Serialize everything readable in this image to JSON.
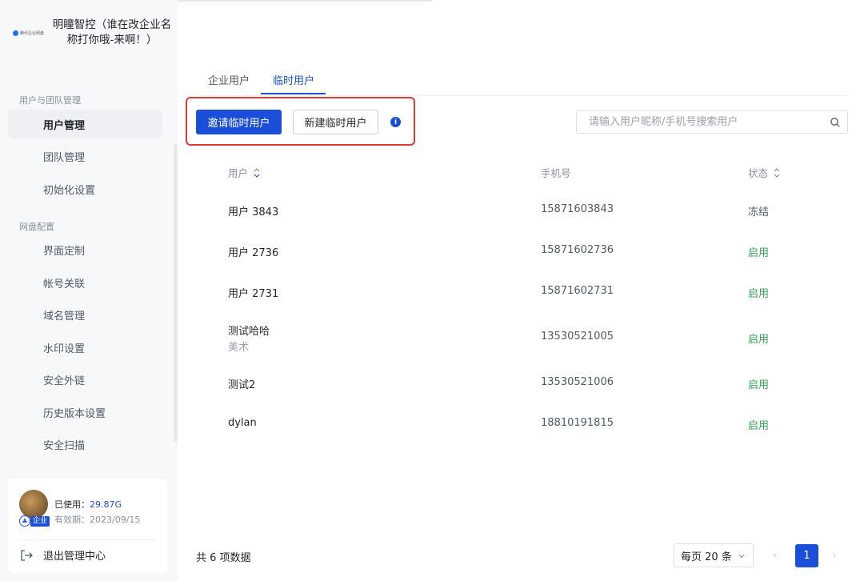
{
  "brand": {
    "name": "明瞳智控（谁在改企业名称打你哦-来啊！）",
    "logo_text": "腾讯企业网盘",
    "accent_color": "#1b4fd8"
  },
  "sidebar": {
    "sections": [
      {
        "label": "用户与团队管理"
      },
      {
        "label": "网盘配置"
      }
    ],
    "items": [
      {
        "label": "用户管理",
        "active": true
      },
      {
        "label": "团队管理"
      },
      {
        "label": "初始化设置"
      },
      {
        "label": "界面定制"
      },
      {
        "label": "帐号关联"
      },
      {
        "label": "域名管理"
      },
      {
        "label": "水印设置"
      },
      {
        "label": "安全外链"
      },
      {
        "label": "历史版本设置"
      },
      {
        "label": "安全扫描"
      }
    ],
    "account": {
      "used_label": "已使用：",
      "used_value": "29.87G",
      "expiry_label": "有效期：",
      "expiry_value": "2023/09/15",
      "badge": "企业"
    },
    "logout_label": "退出管理中心"
  },
  "tabs": [
    {
      "label": "企业用户",
      "active": false
    },
    {
      "label": "临时用户",
      "active": true
    }
  ],
  "toolbar": {
    "invite_label": "邀请临时用户",
    "create_label": "新建临时用户",
    "info_glyph": "i",
    "search_placeholder": "请输入用户昵称/手机号搜索用户"
  },
  "table": {
    "columns": [
      "用户",
      "手机号",
      "状态"
    ],
    "rows": [
      {
        "name": "用户 3843",
        "sub": "",
        "phone": "15871603843",
        "status": "冻结",
        "status_color": "#4e5969"
      },
      {
        "name": "用户 2736",
        "sub": "",
        "phone": "15871602736",
        "status": "启用",
        "status_color": "#2fa84f"
      },
      {
        "name": "用户 2731",
        "sub": "",
        "phone": "15871602731",
        "status": "启用",
        "status_color": "#2fa84f"
      },
      {
        "name": "测试哈哈",
        "sub": "美术",
        "phone": "13530521005",
        "status": "启用",
        "status_color": "#2fa84f"
      },
      {
        "name": "测试2",
        "sub": "",
        "phone": "13530521006",
        "status": "启用",
        "status_color": "#2fa84f"
      },
      {
        "name": "dylan",
        "sub": "",
        "phone": "18810191815",
        "status": "启用",
        "status_color": "#2fa84f"
      }
    ]
  },
  "footer": {
    "total_label": "共 6 项数据",
    "page_size_label": "每页 20 条",
    "current_page": "1",
    "prev_glyph": "‹",
    "next_glyph": "›"
  }
}
